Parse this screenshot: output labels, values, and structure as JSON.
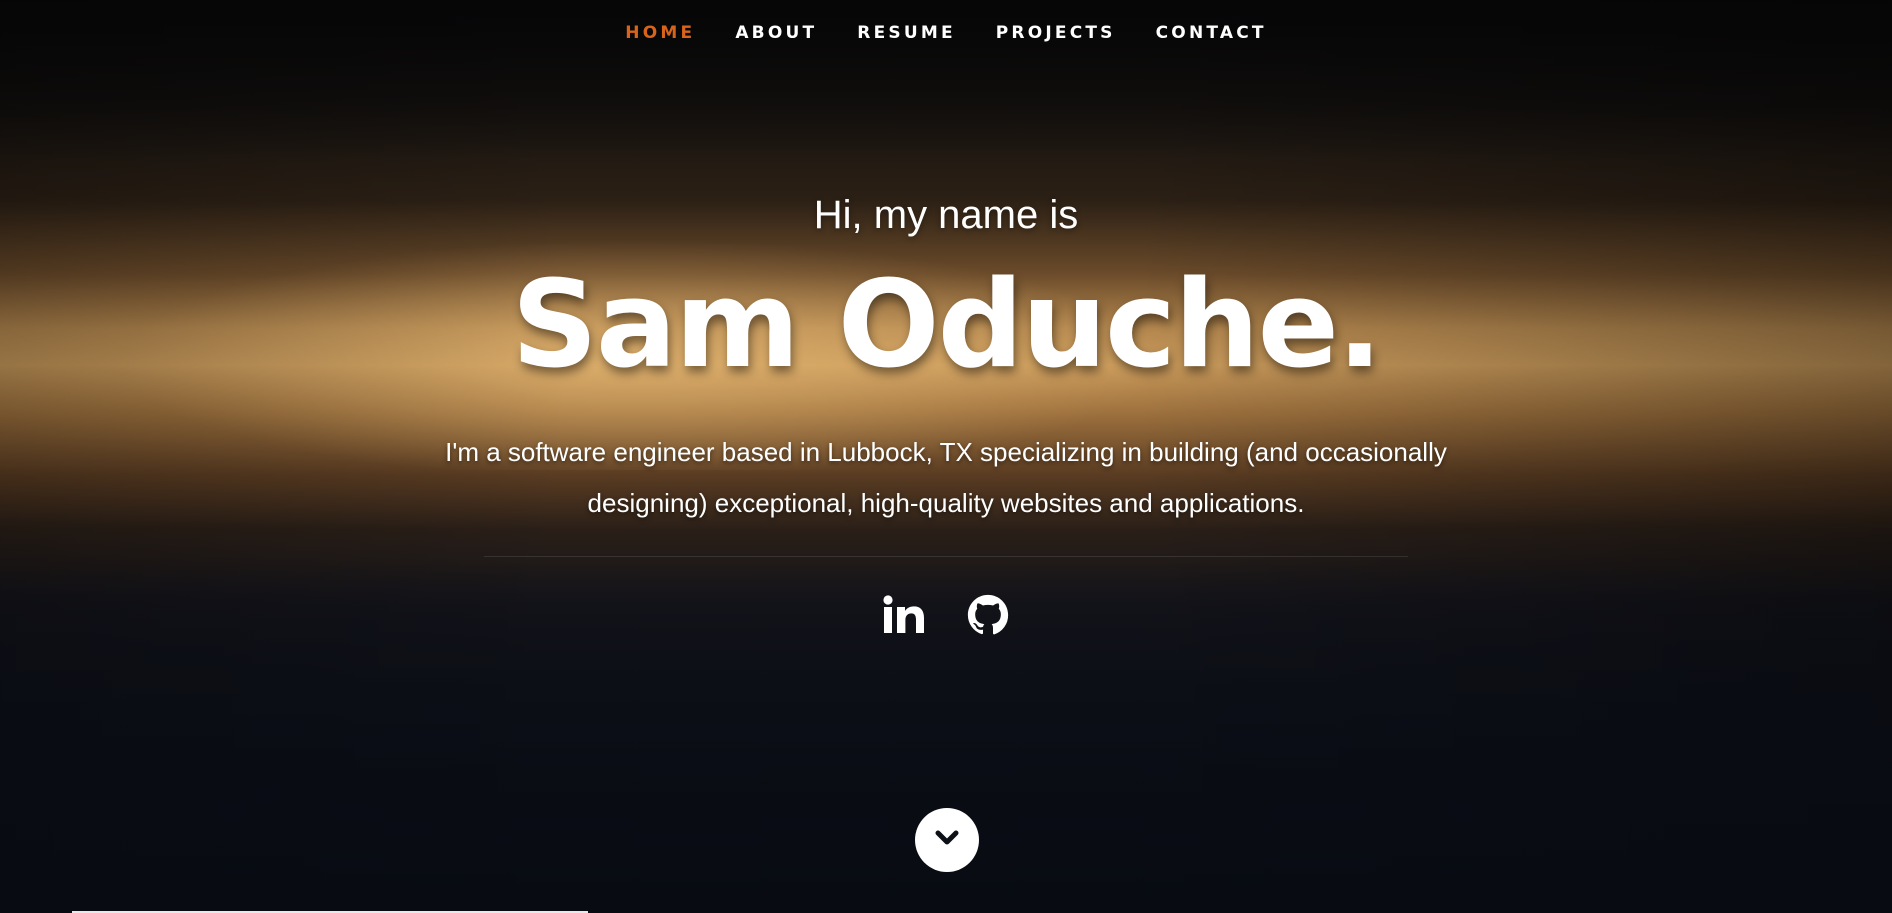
{
  "nav": {
    "items": [
      {
        "label": "HOME",
        "active": true
      },
      {
        "label": "ABOUT",
        "active": false
      },
      {
        "label": "RESUME",
        "active": false
      },
      {
        "label": "PROJECTS",
        "active": false
      },
      {
        "label": "CONTACT",
        "active": false
      }
    ],
    "active_color": "#d8641c"
  },
  "hero": {
    "greeting": "Hi, my name is",
    "name": "Sam Oduche.",
    "bio": "I'm a software engineer based in Lubbock, TX specializing in building (and occasionally designing) exceptional, high-quality websites and applications."
  },
  "social": {
    "links": [
      {
        "icon": "linkedin-icon"
      },
      {
        "icon": "github-icon"
      }
    ]
  },
  "scroll": {
    "icon": "chevron-down-icon"
  }
}
